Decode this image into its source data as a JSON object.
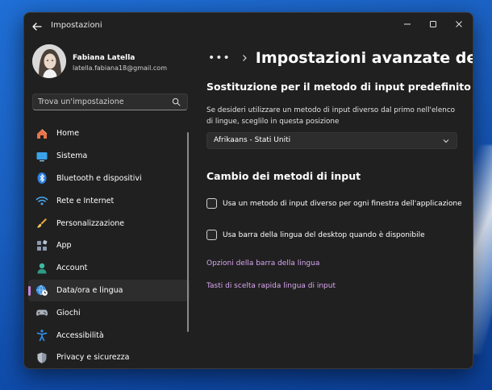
{
  "window": {
    "title": "Impostazioni"
  },
  "user": {
    "name": "Fabiana Latella",
    "email": "latella.fabiana18@gmail.com"
  },
  "search": {
    "placeholder": "Trova un'impostazione"
  },
  "sidebar": {
    "items": [
      {
        "label": "Home",
        "icon": "home-icon"
      },
      {
        "label": "Sistema",
        "icon": "system-icon"
      },
      {
        "label": "Bluetooth e dispositivi",
        "icon": "bluetooth-icon"
      },
      {
        "label": "Rete e Internet",
        "icon": "wifi-icon"
      },
      {
        "label": "Personalizzazione",
        "icon": "paintbrush-icon"
      },
      {
        "label": "App",
        "icon": "apps-icon"
      },
      {
        "label": "Account",
        "icon": "account-icon"
      },
      {
        "label": "Data/ora e lingua",
        "icon": "globe-clock-icon",
        "active": true
      },
      {
        "label": "Giochi",
        "icon": "gamepad-icon"
      },
      {
        "label": "Accessibilità",
        "icon": "accessibility-icon"
      },
      {
        "label": "Privacy e sicurezza",
        "icon": "shield-icon"
      }
    ]
  },
  "breadcrumb": {
    "more": "•••",
    "title": "Impostazioni avanzate della ta"
  },
  "override": {
    "title": "Sostituzione per il metodo di input predefinito",
    "description": "Se desideri utilizzare un metodo di input diverso dal primo nell'elenco di lingue, sceglilo in questa posizione",
    "selected": "Afrikaans - Stati Uniti"
  },
  "switching": {
    "title": "Cambio dei metodi di input",
    "options": [
      {
        "label": "Usa un metodo di input diverso per ogni finestra dell'applicazione",
        "checked": false
      },
      {
        "label": "Usa barra della lingua del desktop quando è disponibile",
        "checked": false
      }
    ]
  },
  "links": {
    "language_bar_options": "Opzioni della barra della lingua",
    "hotkeys": "Tasti di scelta rapida lingua di input"
  },
  "colors": {
    "accent": "#c387dd",
    "link": "#d8a6ef",
    "window_bg": "#202020"
  }
}
